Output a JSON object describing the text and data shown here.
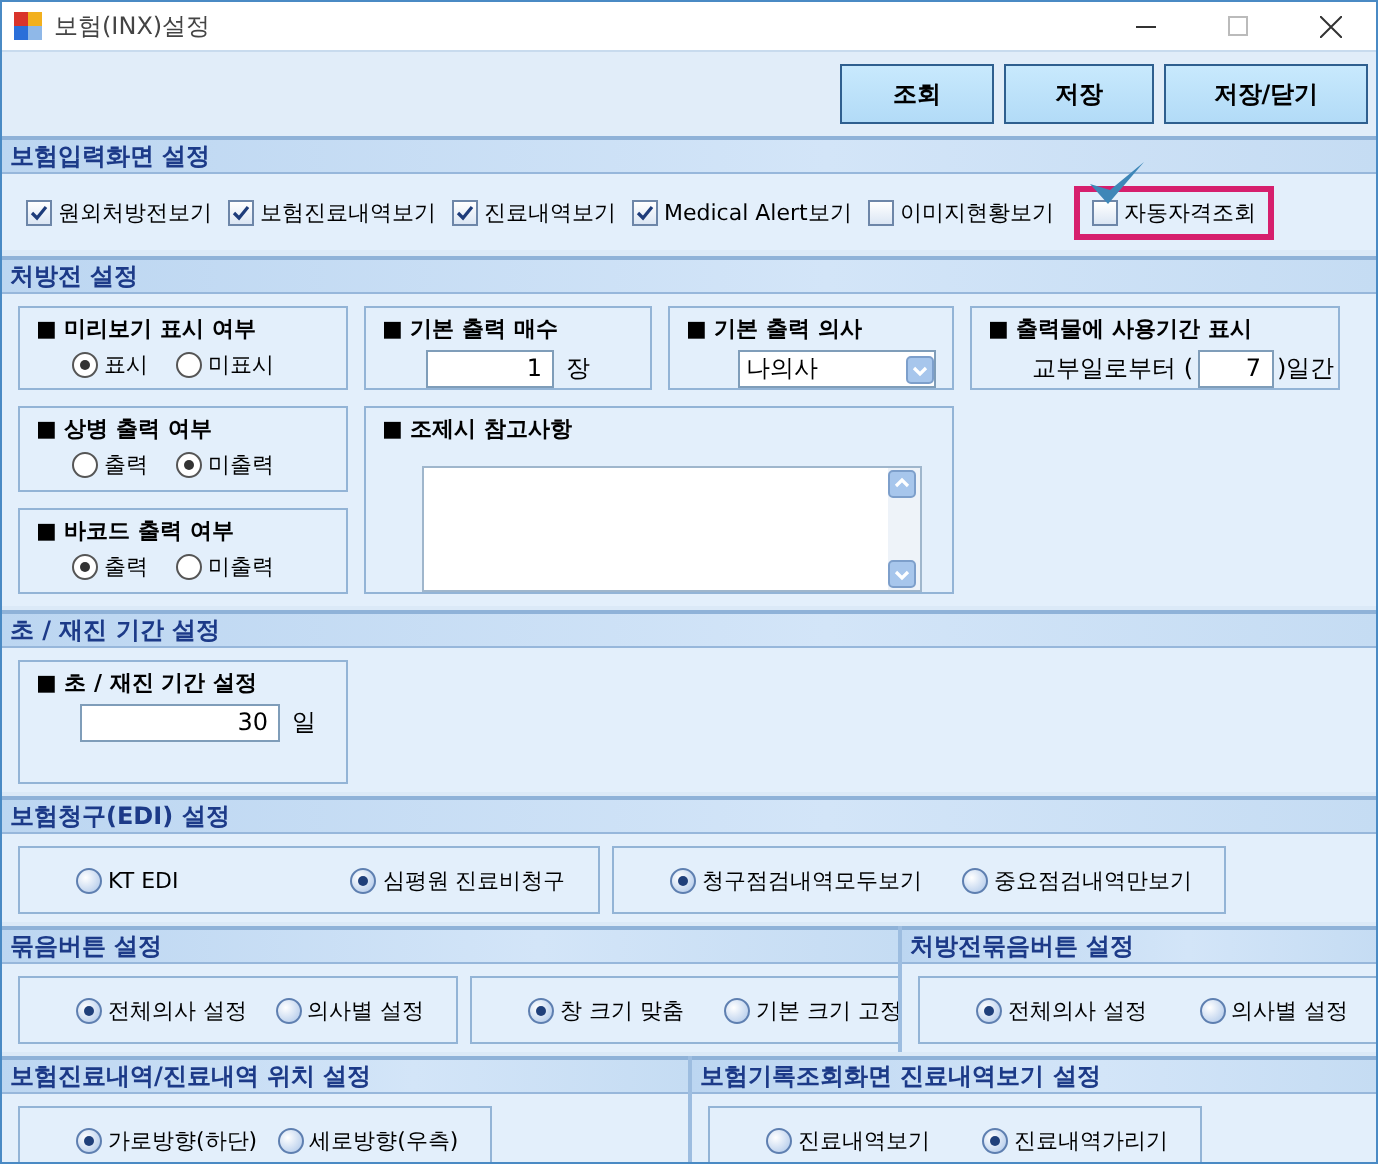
{
  "window": {
    "title": "보험(INX)설정"
  },
  "toolbar": {
    "buttons": [
      "조회",
      "저장",
      "저장/닫기"
    ]
  },
  "input_screen": {
    "title": "보험입력화면 설정",
    "checkboxes": [
      {
        "label": "원외처방전보기",
        "checked": true,
        "highlighted": false
      },
      {
        "label": "보험진료내역보기",
        "checked": true,
        "highlighted": false
      },
      {
        "label": "진료내역보기",
        "checked": true,
        "highlighted": false
      },
      {
        "label": "Medical Alert보기",
        "checked": true,
        "highlighted": false
      },
      {
        "label": "이미지현황보기",
        "checked": false,
        "highlighted": false
      },
      {
        "label": "자동자격조회",
        "checked": false,
        "highlighted": true
      }
    ]
  },
  "prescription": {
    "title": "처방전 설정",
    "groups": [
      {
        "kind": "radios",
        "title": "■ 미리보기 표시 여부",
        "options": [
          {
            "label": "표시",
            "selected": true
          },
          {
            "label": "미표시",
            "selected": false
          }
        ]
      },
      {
        "kind": "number",
        "title": "■ 기본 출력 매수",
        "value": "1",
        "unit": "장"
      },
      {
        "kind": "select",
        "title": "■ 기본 출력 의사",
        "value": "나의사"
      },
      {
        "kind": "period",
        "title": "■ 출력물에 사용기간 표시",
        "prefix": "교부일로부터 (",
        "value": "7",
        "suffix": ")일간"
      },
      {
        "kind": "radios",
        "title": "■ 상병 출력 여부",
        "options": [
          {
            "label": "출력",
            "selected": false
          },
          {
            "label": "미출력",
            "selected": true
          }
        ]
      },
      {
        "kind": "textarea",
        "title": "■ 조제시 참고사항"
      },
      {
        "kind": "radios",
        "title": "■ 바코드 출력 여부",
        "options": [
          {
            "label": "출력",
            "selected": true
          },
          {
            "label": "미출력",
            "selected": false
          }
        ]
      }
    ]
  },
  "rows": [
    {
      "sections": [
        {
          "title": "초 / 재진 기간 설정",
          "groups": [
            {
              "kind": "number",
              "title": "■ 초 / 재진 기간 설정",
              "value": "30",
              "unit": "일"
            }
          ]
        }
      ]
    },
    {
      "sections": [
        {
          "title": "보험청구(EDI) 설정",
          "groups": [
            {
              "kind": "radios",
              "options": [
                {
                  "label": "KT EDI",
                  "selected": false
                },
                {
                  "label": "심평원 진료비청구",
                  "selected": true
                }
              ]
            },
            {
              "kind": "radios",
              "options": [
                {
                  "label": "청구점검내역모두보기",
                  "selected": true
                },
                {
                  "label": "중요점검내역만보기",
                  "selected": false
                }
              ]
            }
          ]
        }
      ]
    },
    {
      "sections": [
        {
          "title": "묶음버튼 설정",
          "groups": [
            {
              "kind": "radios",
              "options": [
                {
                  "label": "전체의사 설정",
                  "selected": true
                },
                {
                  "label": "의사별 설정",
                  "selected": false
                }
              ]
            },
            {
              "kind": "radios",
              "options": [
                {
                  "label": "창 크기 맞춤",
                  "selected": true
                },
                {
                  "label": "기본 크기 고정",
                  "selected": false
                }
              ]
            }
          ]
        },
        {
          "title": "처방전묶음버튼 설정",
          "groups": [
            {
              "kind": "radios",
              "options": [
                {
                  "label": "전체의사 설정",
                  "selected": true
                },
                {
                  "label": "의사별 설정",
                  "selected": false
                }
              ]
            }
          ]
        }
      ]
    },
    {
      "sections": [
        {
          "title": "보험진료내역/진료내역 위치 설정",
          "groups": [
            {
              "kind": "radios",
              "options": [
                {
                  "label": "가로방향(하단)",
                  "selected": true
                },
                {
                  "label": "세로방향(우측)",
                  "selected": false
                }
              ]
            }
          ]
        },
        {
          "title": "보험기록조회화면 진료내역보기 설정",
          "groups": [
            {
              "kind": "radios",
              "options": [
                {
                  "label": "진료내역보기",
                  "selected": false
                },
                {
                  "label": "진료내역가리기",
                  "selected": true
                }
              ]
            }
          ]
        }
      ]
    }
  ]
}
